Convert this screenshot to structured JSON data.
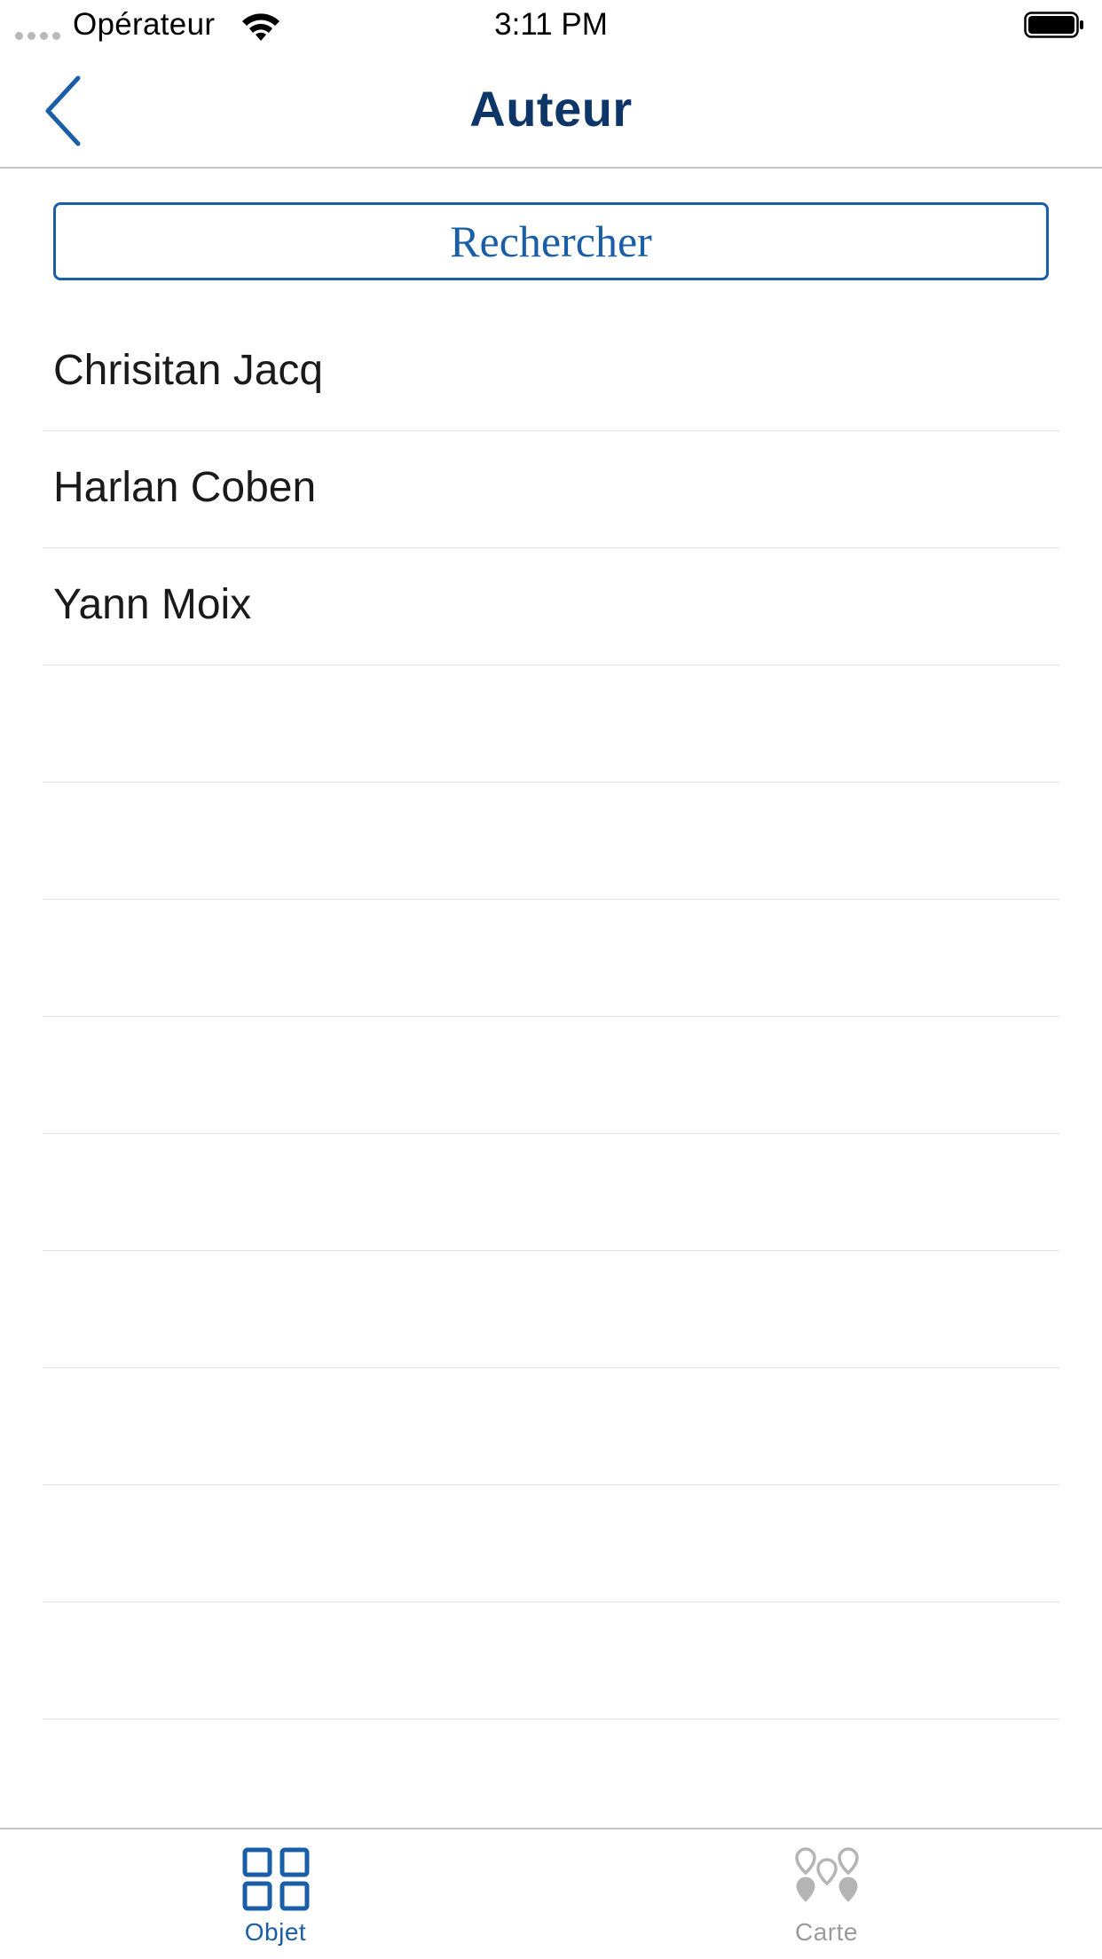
{
  "status_bar": {
    "carrier": "Opérateur",
    "time": "3:11 PM"
  },
  "nav": {
    "title": "Auteur",
    "back_icon": "chevron-left-icon"
  },
  "search": {
    "label": "Rechercher"
  },
  "authors": [
    "Chrisitan Jacq",
    "Harlan Coben",
    "Yann Moix"
  ],
  "tabs": [
    {
      "label": "Objet",
      "icon": "grid-icon",
      "active": true
    },
    {
      "label": "Carte",
      "icon": "map-pins-icon",
      "active": false
    }
  ],
  "colors": {
    "accent": "#1a5ea8",
    "title": "#0d3567",
    "inactive": "#9b9b9b"
  }
}
